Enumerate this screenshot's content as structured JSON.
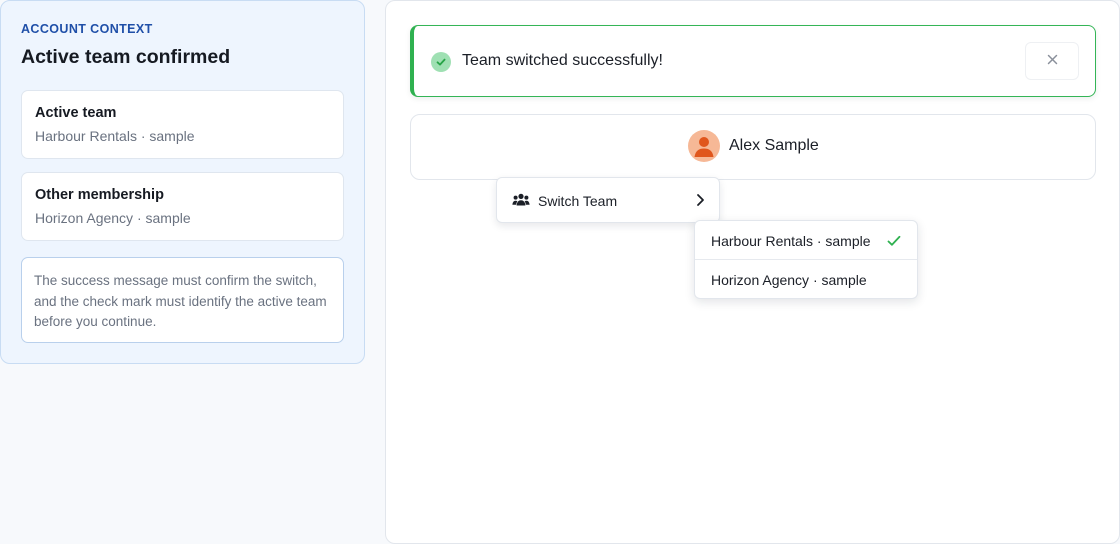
{
  "sidebar": {
    "eyebrow": "ACCOUNT CONTEXT",
    "title": "Active team confirmed",
    "cards": [
      {
        "label": "Active team",
        "value": "Harbour Rentals · sample"
      },
      {
        "label": "Other membership",
        "value": "Horizon Agency · sample"
      }
    ],
    "note": "The success message must confirm the switch, and the check mark must identify the active team before you continue."
  },
  "toast": {
    "message": "Team switched successfully!",
    "status_color": "#2fb150",
    "close_icon": "close-icon"
  },
  "user": {
    "name": "Alex Sample",
    "avatar_color": "#f6b896"
  },
  "menu": {
    "switch_team_label": "Switch Team",
    "icon": "users-icon",
    "submenu": [
      {
        "label": "Harbour Rentals · sample",
        "selected": true
      },
      {
        "label": "Horizon Agency · sample",
        "selected": false
      }
    ]
  },
  "colors": {
    "accent": "#1f4fa8",
    "success": "#2fb150"
  }
}
